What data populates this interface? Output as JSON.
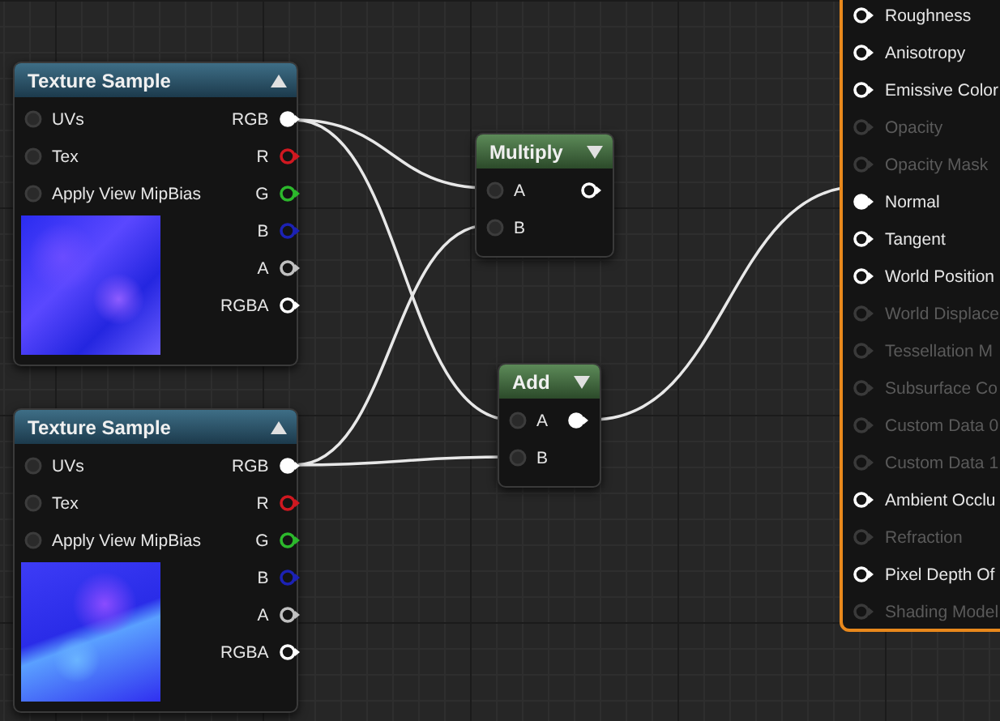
{
  "nodes": [
    {
      "kind": "texture",
      "title": "Texture Sample",
      "inputs": [
        {
          "label": "UVs"
        },
        {
          "label": "Tex"
        },
        {
          "label": "Apply View MipBias"
        }
      ],
      "outputs": [
        {
          "label": "RGB",
          "color": "#ffffff",
          "connected": true
        },
        {
          "label": "R",
          "color": "#d01820",
          "connected": false
        },
        {
          "label": "G",
          "color": "#2cb82c",
          "connected": false
        },
        {
          "label": "B",
          "color": "#1c22b4",
          "connected": false
        },
        {
          "label": "A",
          "color": "#c0c0c0",
          "connected": false
        },
        {
          "label": "RGBA",
          "color": "#ffffff",
          "connected": false
        }
      ]
    },
    {
      "kind": "texture",
      "title": "Texture Sample",
      "inputs": [
        {
          "label": "UVs"
        },
        {
          "label": "Tex"
        },
        {
          "label": "Apply View MipBias"
        }
      ],
      "outputs": [
        {
          "label": "RGB",
          "color": "#ffffff",
          "connected": true
        },
        {
          "label": "R",
          "color": "#d01820",
          "connected": false
        },
        {
          "label": "G",
          "color": "#2cb82c",
          "connected": false
        },
        {
          "label": "B",
          "color": "#1c22b4",
          "connected": false
        },
        {
          "label": "A",
          "color": "#c0c0c0",
          "connected": false
        },
        {
          "label": "RGBA",
          "color": "#ffffff",
          "connected": false
        }
      ]
    },
    {
      "kind": "math",
      "title": "Multiply",
      "inputs": [
        {
          "label": "A"
        },
        {
          "label": "B"
        }
      ],
      "outputs": [
        {
          "color": "#ffffff",
          "connected": false
        }
      ]
    },
    {
      "kind": "math",
      "title": "Add",
      "inputs": [
        {
          "label": "A"
        },
        {
          "label": "B"
        }
      ],
      "outputs": [
        {
          "color": "#ffffff",
          "connected": true
        }
      ]
    }
  ],
  "result": {
    "pins": [
      {
        "label": "Roughness",
        "enabled": true,
        "connected": false
      },
      {
        "label": "Anisotropy",
        "enabled": true,
        "connected": false
      },
      {
        "label": "Emissive Color",
        "enabled": true,
        "connected": false
      },
      {
        "label": "Opacity",
        "enabled": false,
        "connected": false
      },
      {
        "label": "Opacity Mask",
        "enabled": false,
        "connected": false
      },
      {
        "label": "Normal",
        "enabled": true,
        "connected": true
      },
      {
        "label": "Tangent",
        "enabled": true,
        "connected": false
      },
      {
        "label": "World Position",
        "enabled": true,
        "connected": false
      },
      {
        "label": "World Displace",
        "enabled": false,
        "connected": false
      },
      {
        "label": "Tessellation M",
        "enabled": false,
        "connected": false
      },
      {
        "label": "Subsurface Co",
        "enabled": false,
        "connected": false
      },
      {
        "label": "Custom Data 0",
        "enabled": false,
        "connected": false
      },
      {
        "label": "Custom Data 1",
        "enabled": false,
        "connected": false
      },
      {
        "label": "Ambient Occlu",
        "enabled": true,
        "connected": false
      },
      {
        "label": "Refraction",
        "enabled": false,
        "connected": false
      },
      {
        "label": "Pixel Depth Of",
        "enabled": true,
        "connected": false
      },
      {
        "label": "Shading Model",
        "enabled": false,
        "connected": false
      }
    ]
  }
}
